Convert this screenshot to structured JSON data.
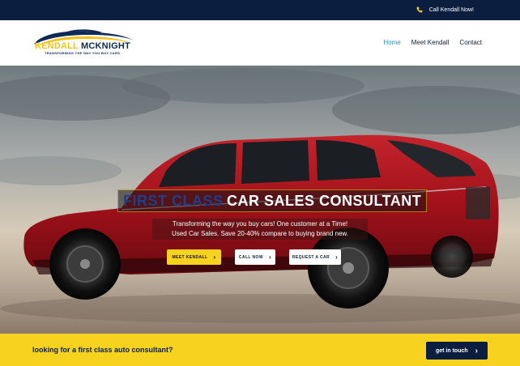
{
  "topbar": {
    "call_label": "Call Kendall Now!"
  },
  "logo": {
    "name_first": "KENDALL",
    "name_last": "MCKNIGHT",
    "tagline": "TRANSFORMING THE WAY YOU BUY CARS"
  },
  "nav": {
    "items": [
      "Home",
      "Meet Kendall",
      "Contact"
    ],
    "active": "Home"
  },
  "hero": {
    "headline_part1": "FIRST CLASS",
    "headline_part2": "CAR SALES CONSULTANT",
    "sub_line1": "Transforming the way you buy cars! One customer at a Time!",
    "sub_line2": "Used Car Sales. Save 20-40% compare to buying brand new.",
    "buttons": [
      "MEET KENDALL",
      "CALL NOW",
      "REQUEST A CAR"
    ]
  },
  "cta": {
    "question": "looking for a first class auto consultant?",
    "button": "get in touch"
  },
  "colors": {
    "navy": "#0b1e3f",
    "yellow": "#f7d21e",
    "link_blue": "#2e93c9",
    "car_red": "#a1111a"
  }
}
